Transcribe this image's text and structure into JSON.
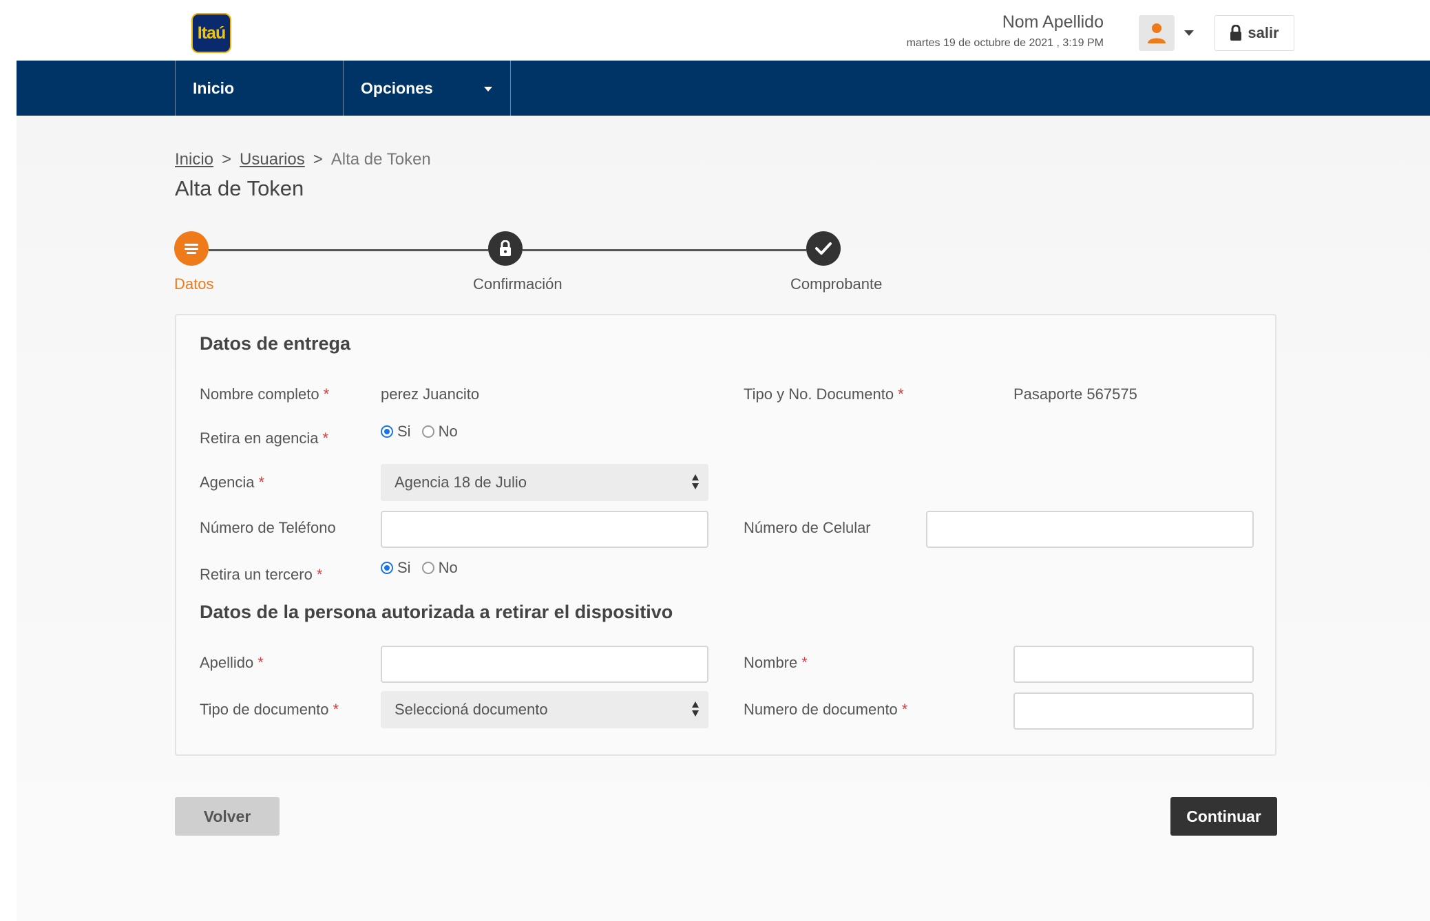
{
  "header": {
    "logo_text": "Itaú",
    "user_name": "Nom Apellido",
    "date": "martes 19 de octubre de 2021 , 3:19 PM",
    "logout_label": "salir"
  },
  "nav": {
    "inicio": "Inicio",
    "opciones": "Opciones"
  },
  "breadcrumb": {
    "items": [
      "Inicio",
      "Usuarios",
      "Alta de Token"
    ],
    "separator": ">"
  },
  "page_title": "Alta de Token",
  "stepper": {
    "steps": [
      {
        "label": "Datos",
        "state": "active",
        "icon": "list-icon"
      },
      {
        "label": "Confirmación",
        "state": "pending",
        "icon": "lock-icon"
      },
      {
        "label": "Comprobante",
        "state": "pending",
        "icon": "check-icon"
      }
    ]
  },
  "delivery": {
    "title": "Datos de entrega",
    "nombre_label": "Nombre completo",
    "nombre_value": "perez Juancito",
    "doc_label": "Tipo y No. Documento",
    "doc_value": "Pasaporte 567575",
    "retira_agencia_label": "Retira en agencia",
    "retira_agencia_options": [
      "Si",
      "No"
    ],
    "retira_agencia_selected": "Si",
    "agencia_label": "Agencia",
    "agencia_value": "Agencia 18 de Julio",
    "telefono_label": "Número de Teléfono",
    "telefono_value": "",
    "celular_label": "Número de Celular",
    "celular_value": "",
    "retira_tercero_label": "Retira un tercero",
    "retira_tercero_options": [
      "Si",
      "No"
    ],
    "retira_tercero_selected": "Si"
  },
  "authorized": {
    "title": "Datos de la persona autorizada a retirar el dispositivo",
    "apellido_label": "Apellido",
    "apellido_value": "",
    "nombre_label": "Nombre",
    "nombre_value": "",
    "tipo_doc_label": "Tipo de documento",
    "tipo_doc_value": "Seleccioná documento",
    "numero_doc_label": "Numero de documento",
    "numero_doc_value": ""
  },
  "required_mark": "*",
  "buttons": {
    "back": "Volver",
    "continue": "Continuar"
  },
  "colors": {
    "navbar": "#003366",
    "accent": "#ee7a1a",
    "step_pending": "#333333",
    "radio_selected": "#1a73e8",
    "required": "#e23a3a"
  }
}
